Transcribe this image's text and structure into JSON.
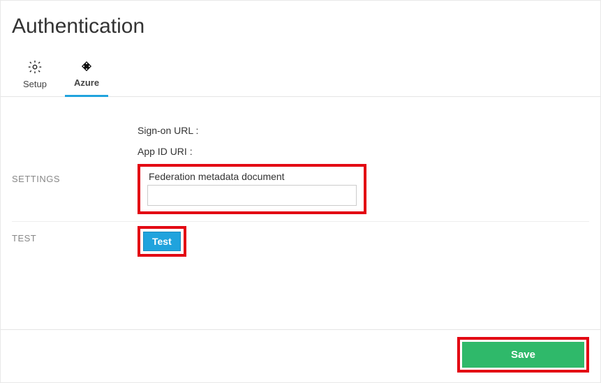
{
  "page": {
    "title": "Authentication"
  },
  "tabs": {
    "setup_label": "Setup",
    "azure_label": "Azure"
  },
  "sections": {
    "settings_label": "SETTINGS",
    "test_label": "TEST"
  },
  "settings": {
    "signon_url": {
      "label": "Sign-on URL :"
    },
    "app_id_uri": {
      "label": "App ID URI :"
    },
    "federation": {
      "label": "Federation metadata document",
      "value": ""
    }
  },
  "buttons": {
    "test_label": "Test",
    "save_label": "Save"
  }
}
